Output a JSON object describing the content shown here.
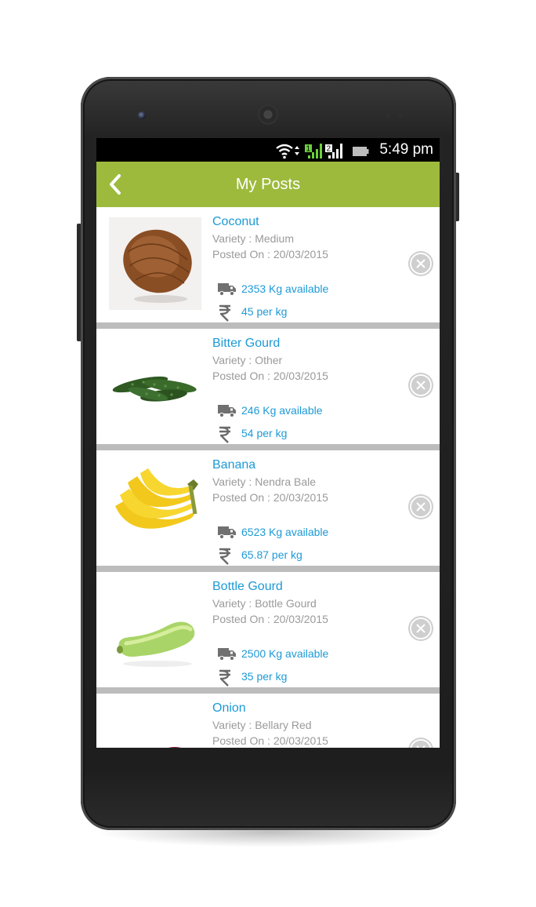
{
  "status_bar": {
    "time": "5:49 pm",
    "sim1": "1",
    "sim2": "2"
  },
  "app_bar": {
    "title": "My Posts"
  },
  "posts": [
    {
      "name": "Coconut",
      "variety": "Variety : Medium",
      "posted": "Posted On : 20/03/2015",
      "quantity": "2353 Kg available",
      "price": "45 per kg"
    },
    {
      "name": "Bitter Gourd",
      "variety": "Variety : Other",
      "posted": "Posted On : 20/03/2015",
      "quantity": "246 Kg available",
      "price": "54 per kg"
    },
    {
      "name": "Banana",
      "variety": "Variety : Nendra Bale",
      "posted": "Posted On : 20/03/2015",
      "quantity": "6523 Kg available",
      "price": "65.87 per kg"
    },
    {
      "name": "Bottle Gourd",
      "variety": "Variety : Bottle Gourd",
      "posted": "Posted On : 20/03/2015",
      "quantity": "2500 Kg available",
      "price": "35 per kg"
    },
    {
      "name": "Onion",
      "variety": "Variety : Bellary Red",
      "posted": "Posted On : 20/03/2015"
    }
  ],
  "colors": {
    "accent": "#9dba3d",
    "link": "#1d9ad6",
    "muted": "#9a9a9a"
  }
}
